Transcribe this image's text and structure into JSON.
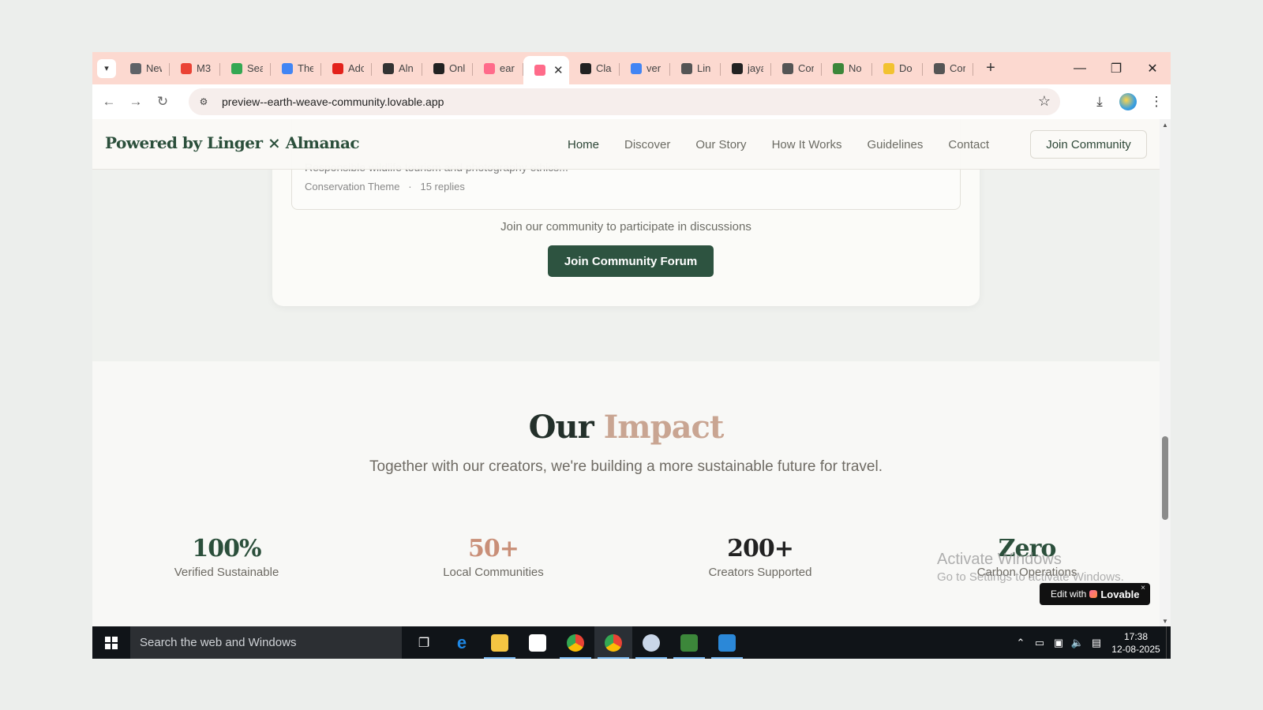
{
  "browser": {
    "tabs": [
      {
        "label": "New",
        "icon": "chrome-icon",
        "color": "#5f6368"
      },
      {
        "label": "M3",
        "icon": "gmail-icon",
        "color": "#ea4335"
      },
      {
        "label": "Sea",
        "icon": "drive-icon",
        "color": "#34a853"
      },
      {
        "label": "The",
        "icon": "docs-icon",
        "color": "#4285f4"
      },
      {
        "label": "Adc",
        "icon": "adobe-icon",
        "color": "#e3221b"
      },
      {
        "label": "Aln",
        "icon": "openai-icon",
        "color": "#333333"
      },
      {
        "label": "Onl",
        "icon": "d-icon",
        "color": "#222222"
      },
      {
        "label": "ear",
        "icon": "lovable-icon",
        "color": "#ff6b8a"
      },
      {
        "label": "",
        "icon": "lovable-icon",
        "color": "#ff6b8a",
        "active": true
      },
      {
        "label": "Cla",
        "icon": "anthropic-icon",
        "color": "#222222"
      },
      {
        "label": "ver",
        "icon": "google-icon",
        "color": "#4285f4"
      },
      {
        "label": "Lin",
        "icon": "globe-icon",
        "color": "#555555"
      },
      {
        "label": "jaya",
        "icon": "github-icon",
        "color": "#222222"
      },
      {
        "label": "Cor",
        "icon": "globe-icon",
        "color": "#555555"
      },
      {
        "label": "No",
        "icon": "node-icon",
        "color": "#3c873a"
      },
      {
        "label": "Do",
        "icon": "python-icon",
        "color": "#f2c230"
      },
      {
        "label": "Cor",
        "icon": "globe-icon",
        "color": "#555555"
      }
    ],
    "url": "preview--earth-weave-community.lovable.app"
  },
  "site": {
    "brand": "Powered by Linger × Almanac",
    "nav": [
      "Home",
      "Discover",
      "Our Story",
      "How It Works",
      "Guidelines",
      "Contact"
    ],
    "join_label": "Join Community"
  },
  "forum": {
    "thread_desc": "Responsible wildlife tourism and photography ethics...",
    "thread_category": "Conservation Theme",
    "thread_replies": "15 replies",
    "participate_text": "Join our community to participate in discussions",
    "button_label": "Join Community Forum"
  },
  "impact": {
    "title_part1": "Our",
    "title_part2": "Impact",
    "subtitle": "Together with our creators, we're building a more sustainable future for travel.",
    "stats": [
      {
        "value": "100%",
        "label": "Verified Sustainable"
      },
      {
        "value": "50+",
        "label": "Local Communities"
      },
      {
        "value": "200+",
        "label": "Creators Supported"
      },
      {
        "value": "Zero",
        "label": "Carbon Operations"
      }
    ]
  },
  "overlay": {
    "activate_title": "Activate Windows",
    "activate_sub": "Go to Settings to activate Windows.",
    "lovable_prefix": "Edit with",
    "lovable_brand": "Lovable",
    "lovable_close": "×"
  },
  "taskbar": {
    "search_placeholder": "Search the web and Windows",
    "time": "17:38",
    "date": "12-08-2025"
  },
  "colors": {
    "brand_green": "#2d5340",
    "accent_rose": "#c9a592",
    "tab_bar": "#fcd9d0"
  }
}
